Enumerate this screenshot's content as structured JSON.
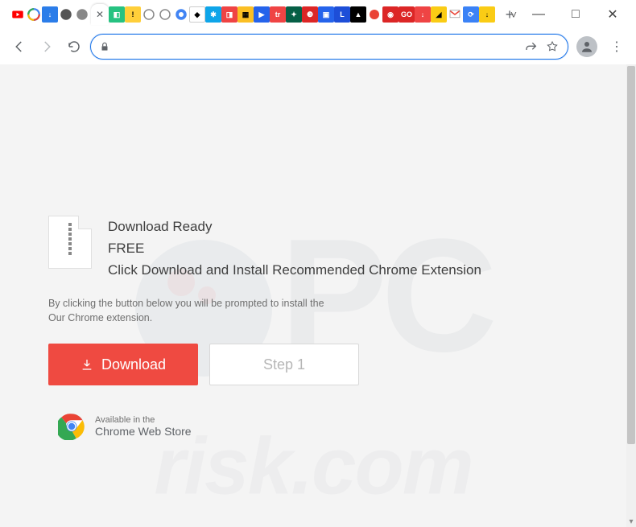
{
  "window": {
    "close": "✕",
    "max": "□",
    "min": "—",
    "dropdown": "˅"
  },
  "tabs": {
    "new_tab_label": "+",
    "active_close": "✕"
  },
  "toolbar": {
    "back_aria": "Back",
    "forward_aria": "Forward",
    "reload_aria": "Reload",
    "url": "",
    "share_aria": "Share",
    "star_aria": "Bookmark",
    "profile_aria": "Profile",
    "menu_aria": "Menu"
  },
  "page": {
    "hero_line1": "Download Ready",
    "hero_line2": "FREE",
    "hero_line3": "Click Download and Install Recommended Chrome Extension",
    "sub_line1": "By clicking the button below you will be prompted to install the",
    "sub_line2": "Our Chrome extension.",
    "download_btn": "Download",
    "step_btn": "Step 1",
    "store_small": "Available in the",
    "store_big": "Chrome Web Store"
  },
  "watermark": {
    "line1": "PC",
    "line2": "risk.com"
  }
}
